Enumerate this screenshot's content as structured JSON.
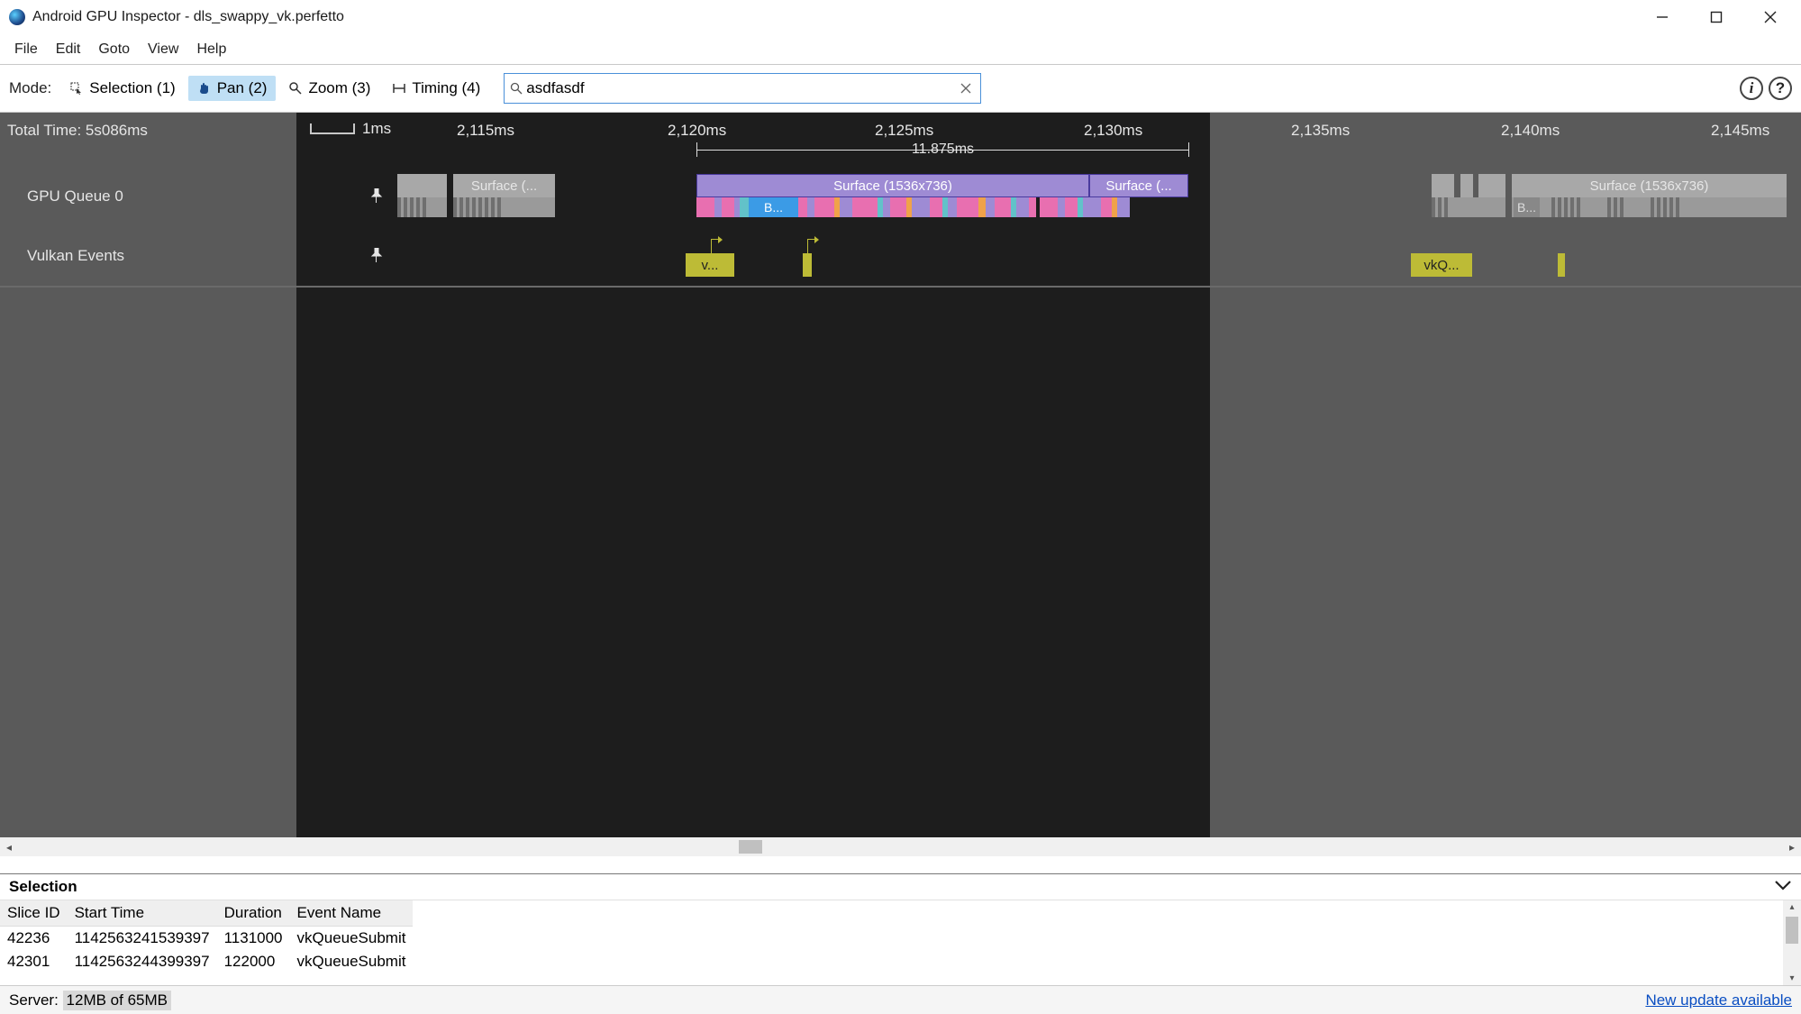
{
  "window": {
    "title": "Android GPU Inspector - dls_swappy_vk.perfetto"
  },
  "menu": {
    "file": "File",
    "edit": "Edit",
    "goto": "Goto",
    "view": "View",
    "help": "Help"
  },
  "toolbar": {
    "mode_label": "Mode:",
    "selection": "Selection (1)",
    "pan": "Pan (2)",
    "zoom": "Zoom (3)",
    "timing": "Timing (4)",
    "search_value": "asdfasdf"
  },
  "ruler": {
    "total_time": "Total Time: 5s086ms",
    "scale": "1ms",
    "range": "11.875ms",
    "ticks": [
      "2,115ms",
      "2,120ms",
      "2,125ms",
      "2,130ms",
      "2,135ms",
      "2,140ms",
      "2,145ms"
    ]
  },
  "tracks": {
    "gpu": {
      "name": "GPU Queue 0",
      "events": {
        "surf1": "Surface (...",
        "surf_mid": "Surface (1536x736)",
        "surf_mid2": "Surface (...",
        "surf_right": "Surface (1536x736)",
        "b1": "B...",
        "b2": "B..."
      }
    },
    "vulkan": {
      "name": "Vulkan Events",
      "events": {
        "v1": "v...",
        "v2": "vkQ..."
      }
    }
  },
  "selection": {
    "title": "Selection",
    "columns": {
      "slice_id": "Slice ID",
      "start_time": "Start Time",
      "duration": "Duration",
      "event_name": "Event Name"
    },
    "rows": [
      {
        "slice_id": "42236",
        "start_time": "1142563241539397",
        "duration": "1131000",
        "event_name": "vkQueueSubmit"
      },
      {
        "slice_id": "42301",
        "start_time": "1142563244399397",
        "duration": "122000",
        "event_name": "vkQueueSubmit"
      }
    ]
  },
  "status": {
    "server_label": "Server:",
    "server_mem": "12MB of 65MB",
    "update": "New update available"
  }
}
